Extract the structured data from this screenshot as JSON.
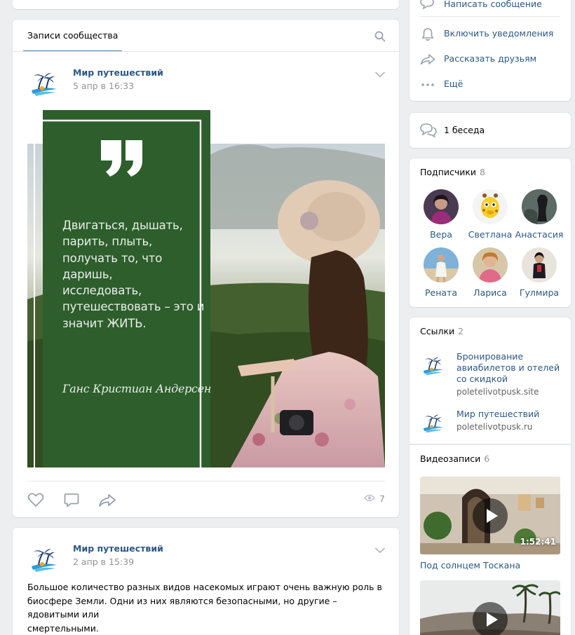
{
  "wall": {
    "tab_label": "Записи сообщества",
    "posts": [
      {
        "author": "Мир путешествий",
        "date": "5 апр в 16:33",
        "image": {
          "quote_text": "Двигаться, дышать,\nпарить, плыть,\nполучать то, что даришь,\nисследовать,\nпутешествовать – это и\nзначит ЖИТЬ.",
          "quote_author": "Ганс Кристиан Андерсен"
        },
        "views": "7"
      },
      {
        "author": "Мир путешествий",
        "date": "2 апр в 15:39",
        "text": "Большое количество разных видов насекомых играют очень важную роль в\nбиосфере Земли. Одни из них являются безопасными, но другие – ядовитыми или\nсмертельными."
      }
    ]
  },
  "sidebar": {
    "actions": {
      "write_message": "Написать сообщение",
      "notifications": "Включить уведомления",
      "share": "Рассказать друзьям",
      "more": "Ещё"
    },
    "chats": {
      "label": "1 беседа"
    },
    "subscribers": {
      "title": "Подписчики",
      "count": "8",
      "people": [
        {
          "name": "Вера"
        },
        {
          "name": "Светлана"
        },
        {
          "name": "Анастасия"
        },
        {
          "name": "Рената"
        },
        {
          "name": "Лариса"
        },
        {
          "name": "Гулмира"
        }
      ]
    },
    "links": {
      "title": "Ссылки",
      "count": "2",
      "items": [
        {
          "title": "Бронирование авиабилетов и отелей со скидкой",
          "url": "poletelivotpusk.site"
        },
        {
          "title": "Мир путешествий",
          "url": "poletelivotpusk.ru"
        }
      ]
    },
    "videos": {
      "title": "Видеозаписи",
      "count": "6",
      "items": [
        {
          "title": "Под солнцем Тоскана",
          "duration": "1:52:41"
        }
      ]
    }
  },
  "colors": {
    "accent": "#5181b8",
    "link": "#2a5885",
    "muted": "#939393",
    "background": "#edeef0",
    "quote_panel": "#2d5e2c"
  }
}
